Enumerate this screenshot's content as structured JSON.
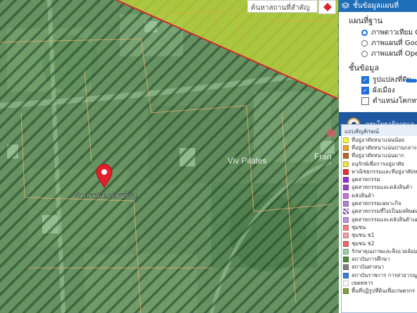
{
  "search": {
    "placeholder": "ค้นหาสถานที่สำคัญ"
  },
  "map": {
    "marker_label": "ตำแหน่งแปลงที่ดิน",
    "place_labels": [
      "Viv Pilates",
      "Fran"
    ]
  },
  "panel": {
    "header": "ชั้นข้อมูลแผนที่",
    "basemap_title": "แผนที่ฐาน",
    "basemaps": [
      {
        "label": "ภาพดาวเทียม G",
        "selected": true
      },
      {
        "label": "ภาพแผนที่ Goo",
        "selected": false
      },
      {
        "label": "ภาพแผนที่ Ope",
        "selected": false
      }
    ],
    "layers_title": "ชั้นข้อมูล",
    "layers": [
      {
        "label": "รูปแปลงที่ดิน",
        "checked": true
      },
      {
        "label": "ผังเมือง",
        "checked": true
      },
      {
        "label": "ตำแหน่งโคกหนอ",
        "checked": false
      }
    ],
    "department": "กรมโยธาธิการแล",
    "legend_title": "แถบสัญลักษณ์",
    "legend": [
      {
        "label": "ที่อยู่อาศัยหนาแน่นน้อย",
        "color": "#f5f542"
      },
      {
        "label": "ที่อยู่อาศัยหนาแน่นปานกลาง",
        "color": "#f0a030"
      },
      {
        "label": "ที่อยู่อาศัยหนาแน่นมาก",
        "color": "#b8652a"
      },
      {
        "label": "อนุรักษ์เพื่อการอยู่อาศัย",
        "color": "#f2e04a"
      },
      {
        "label": "พาณิชยกรรมและที่อยู่อาศัยหน",
        "color": "#e83030"
      },
      {
        "label": "อุตสาหกรรม",
        "color": "#9b30c8"
      },
      {
        "label": "อุตสาหกรรมและคลังสินค้า",
        "color": "#a040c0"
      },
      {
        "label": "คลังสินค้า",
        "color": "#d070e0"
      },
      {
        "label": "อุตสาหกรรมเฉพาะกิจ",
        "color": "#b080d8"
      },
      {
        "label": "อุตสาหกรรมที่ไม่เป็นมลพิษต่อ",
        "color": "#8a40b0"
      },
      {
        "label": "อุตสาหกรรมและคลังสินค้าเฉพ",
        "color": "#c090e0"
      },
      {
        "label": "ชุมชน",
        "color": "#f08080"
      },
      {
        "label": "ชุมชน ช1",
        "color": "#f4a0a0"
      },
      {
        "label": "ชุมชน ช2",
        "color": "#e86a6a"
      },
      {
        "label": "รักษาคุณภาพและสิ่งแวดล้อม",
        "color": "#9ad0a0"
      },
      {
        "label": "สถาบันการศึกษา",
        "color": "#4c8a3c"
      },
      {
        "label": "สถาบันศาสนา",
        "color": "#808080"
      },
      {
        "label": "สถาบันราชการ การสาธารณูป",
        "color": "#3a7fd5"
      },
      {
        "label": "เขตทหาร",
        "color": "#ffffff"
      },
      {
        "label": "พื้นที่ปฏิรูปที่ดินเพื่อเกษตรกร",
        "color": "#7aa03a"
      }
    ]
  },
  "colors": {
    "accent": "#1f6fb8",
    "zone_green": "#3cae4a",
    "zone_yellow": "#c8d43a",
    "marker_red": "#e0202a"
  }
}
